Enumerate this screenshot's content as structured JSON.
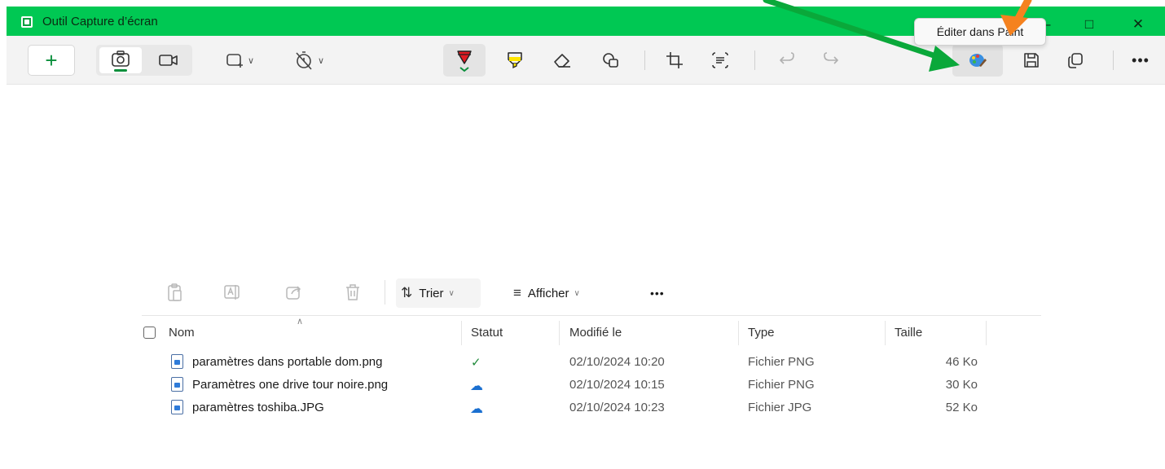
{
  "app": {
    "title": "Outil Capture d’écran",
    "accent_color": "#00c853"
  },
  "window_controls": {
    "minimize_icon": "minimize-icon",
    "maximize_icon": "maximize-icon",
    "close_icon": "close-icon"
  },
  "toolbar": {
    "new_icon": "plus-icon",
    "photo_mode_icon": "camera-icon",
    "video_mode_icon": "video-icon",
    "shape_mode_icon": "rectangle-snip-icon",
    "delay_icon": "no-timer-icon",
    "tools": [
      "ballpoint-pen-icon",
      "highlighter-icon",
      "eraser-icon",
      "shapes-icon",
      "crop-icon",
      "text-actions-icon",
      "undo-icon",
      "redo-icon"
    ],
    "right_tools": [
      "paint-icon",
      "save-icon",
      "copy-icon",
      "more-icon"
    ],
    "tooltip": "Éditer dans Paint",
    "arrow_colors": {
      "green": "#0aa83a",
      "orange": "#f5821f"
    }
  },
  "explorer": {
    "toolbar": {
      "sort_label": "Trier",
      "view_label": "Afficher",
      "more_label": "•••"
    },
    "columns": [
      "Nom",
      "Statut",
      "Modifié le",
      "Type",
      "Taille"
    ],
    "files": [
      {
        "name": "paramètres dans portable dom.png",
        "status": "available-locally",
        "modified": "02/10/2024 10:20",
        "type": "Fichier PNG",
        "size": "46 Ko"
      },
      {
        "name": "Paramètres one drive tour noire.png",
        "status": "cloud-only",
        "modified": "02/10/2024 10:15",
        "type": "Fichier PNG",
        "size": "30 Ko"
      },
      {
        "name": "paramètres toshiba.JPG",
        "status": "cloud-only",
        "modified": "02/10/2024 10:23",
        "type": "Fichier JPG",
        "size": "52 Ko"
      }
    ]
  }
}
